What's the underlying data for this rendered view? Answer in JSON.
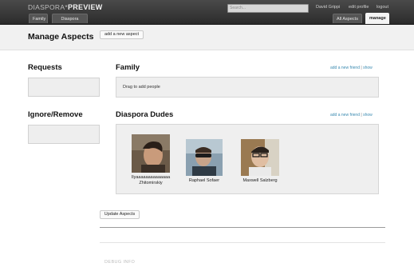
{
  "header": {
    "logo_text": "DIASPORA*",
    "logo_preview": "PREVIEW",
    "search_placeholder": "Search...",
    "user_name": "David Grippi",
    "edit_profile": "edit profile",
    "logout": "logout",
    "tabs": [
      {
        "label": "Family",
        "active": false
      },
      {
        "label": "Diaspora Dudes",
        "active": false
      }
    ],
    "right_tabs": [
      {
        "label": "All Aspects",
        "active": false
      },
      {
        "label": "manage",
        "active": true
      }
    ]
  },
  "manage": {
    "title": "Manage Aspects",
    "add_aspect_label": "add a new aspect"
  },
  "left": {
    "requests_title": "Requests",
    "ignore_title": "Ignore/Remove"
  },
  "aspects": [
    {
      "name": "Family",
      "add_friend": "add a new friend",
      "separator": "|",
      "show": "show",
      "empty_hint": "Drag to add people",
      "people": []
    },
    {
      "name": "Diaspora Dudes",
      "add_friend": "add a new friend",
      "separator": "|",
      "show": "show",
      "people": [
        {
          "name_line1": "Ilyaaaaaaaaaaaaaa",
          "name_line2": "Zhitomirskiy"
        },
        {
          "name_line1": "Raphael Sofaer",
          "name_line2": ""
        },
        {
          "name_line1": "Maxwell Salzberg",
          "name_line2": ""
        }
      ]
    }
  ],
  "footer": {
    "update_label": "Update Aspects",
    "debug_label": "DEBUG INFO"
  },
  "colors": {
    "topbar": "#2b2b2b",
    "link": "#3a8ab0",
    "panel": "#efefef"
  }
}
